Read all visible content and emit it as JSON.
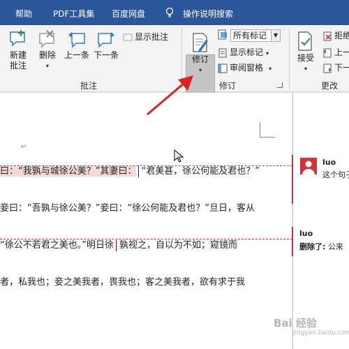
{
  "tabs": [
    "帮助",
    "PDF工具集",
    "百度网盘",
    "操作说明搜索"
  ],
  "comments_group": {
    "new": [
      "新建",
      "批注"
    ],
    "delete": "删除",
    "prev": "上一条",
    "next": "下一条",
    "show": "显示批注",
    "label": "批注"
  },
  "tracking_group": {
    "revise": "修订",
    "markup_select": "所有标记",
    "show_markup": "显示标记",
    "review_pane": "审阅窗格",
    "label": "修订"
  },
  "changes_group": {
    "accept": "接受",
    "reject": "拒绝",
    "prev": "上一",
    "next": "下一",
    "label": "更改"
  },
  "document": {
    "para_mark": "↵",
    "line1_hl": "曰：“我孰与城徐公美？”其妻曰：",
    "line1_rest": "“君美甚，徐公何能及君也？”",
    "line2": "妾曰：“吾孰与徐公美？”妾曰：“徐公何能及君也？”旦日，客从",
    "line3_a": "“徐公不若君之美也。”明日徐",
    "line3_b": "孰视之，自以为不如；窥镜而",
    "line4": "者，私我也；妾之美我者，畏我也；客之美我者，欲有求于我"
  },
  "comments": [
    {
      "author": "luo",
      "text": "这个句子"
    },
    {
      "author": "luo",
      "label": "删除了:",
      "text": "公来"
    }
  ],
  "watermark": {
    "main": "Bai 经验",
    "sub": "jingyan.baidu.com"
  },
  "colors": {
    "ribbon_tab": "#2b579a",
    "markup_red": "#d13438",
    "highlight": "#f6d8d8"
  }
}
